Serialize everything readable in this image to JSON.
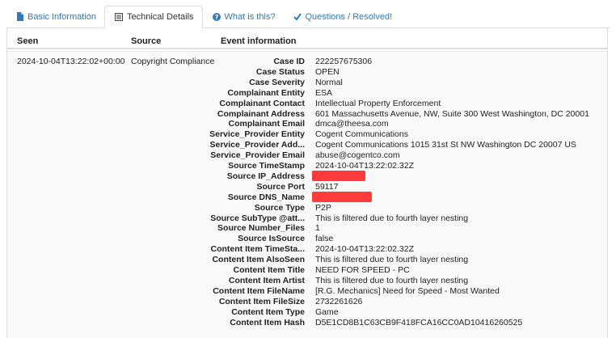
{
  "tabs": [
    {
      "label": "Basic Information",
      "icon": "document-icon",
      "active": false
    },
    {
      "label": "Technical Details",
      "icon": "list-icon",
      "active": true
    },
    {
      "label": "What is this?",
      "icon": "question-circle-icon",
      "active": false
    },
    {
      "label": "Questions / Resolved!",
      "icon": "checkmark-icon",
      "active": false
    }
  ],
  "table": {
    "headers": {
      "seen": "Seen",
      "source": "Source",
      "event": "Event information"
    },
    "row": {
      "seen": "2024-10-04T13:22:02+00:00",
      "source": "Copyright Compliance",
      "details": [
        {
          "key": "Case ID",
          "value": "222257675306"
        },
        {
          "key": "Case Status",
          "value": "OPEN"
        },
        {
          "key": "Case Severity",
          "value": "Normal"
        },
        {
          "key": "Complainant Entity",
          "value": "ESA"
        },
        {
          "key": "Complainant Contact",
          "value": "Intellectual Property Enforcement"
        },
        {
          "key": "Complainant Address",
          "value": "601 Massachusetts Avenue, NW, Suite 300 West Washington, DC 20001"
        },
        {
          "key": "Complainant Email",
          "value": "dmca@theesa.com"
        },
        {
          "key": "Service_Provider Entity",
          "value": "Cogent Communications"
        },
        {
          "key": "Service_Provider Add...",
          "value": "Cogent Communications 1015 31st St NW Washington DC 20007 US"
        },
        {
          "key": "Service_Provider Email",
          "value": "abuse@cogentco.com"
        },
        {
          "key": "Source TimeStamp",
          "value": "2024-10-04T13:22:02.32Z"
        },
        {
          "key": "Source IP_Address",
          "value": "",
          "redacted": true
        },
        {
          "key": "Source Port",
          "value": "59117"
        },
        {
          "key": "Source DNS_Name",
          "value": "",
          "redacted": true
        },
        {
          "key": "Source Type",
          "value": "P2P"
        },
        {
          "key": "Source SubType @att...",
          "value": "This is filtered due to fourth layer nesting"
        },
        {
          "key": "Source Number_Files",
          "value": "1"
        },
        {
          "key": "Source IsSource",
          "value": "false"
        },
        {
          "key": "Content Item TimeSta...",
          "value": "2024-10-04T13:22:02.32Z"
        },
        {
          "key": "Content Item AlsoSeen",
          "value": "This is filtered due to fourth layer nesting"
        },
        {
          "key": "Content Item Title",
          "value": "NEED FOR SPEED - PC"
        },
        {
          "key": "Content Item Artist",
          "value": "This is filtered due to fourth layer nesting"
        },
        {
          "key": "Content Item FileName",
          "value": "[R.G. Mechanics] Need for Speed - Most Wanted"
        },
        {
          "key": "Content Item FileSize",
          "value": "2732261626"
        },
        {
          "key": "Content Item Type",
          "value": "Game"
        },
        {
          "key": "Content Item Hash",
          "value": "D5E1CD8B1C63CB9F418FCA16CC0AD10416260525"
        }
      ]
    }
  },
  "colors": {
    "link": "#337ab7",
    "redaction": "#ff3b3b",
    "border": "#dddddd",
    "row_bg": "#f9f9f9"
  }
}
